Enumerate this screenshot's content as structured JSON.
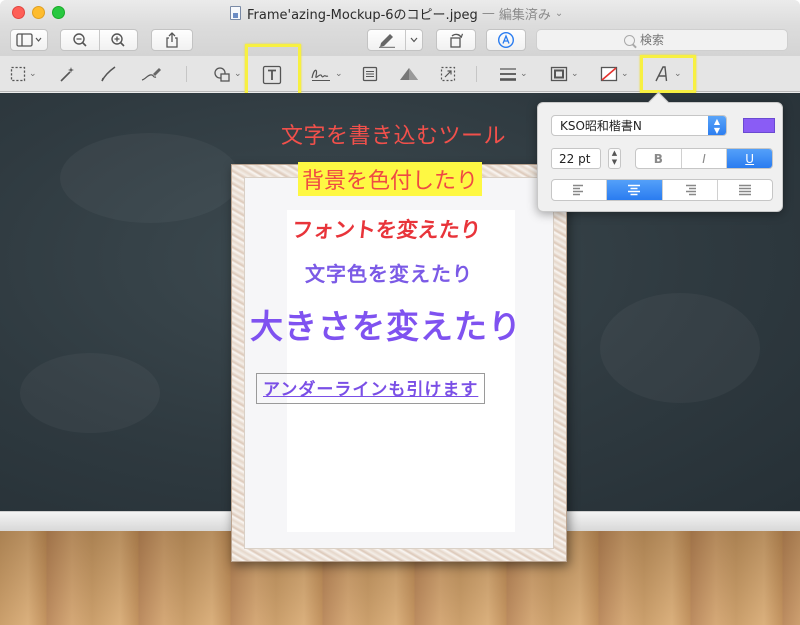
{
  "window": {
    "title": "Frame'azing-Mockup-6のコピー.jpeg",
    "title_separator": "—",
    "status": "編集済み"
  },
  "toolbar": {
    "search_placeholder": "検索"
  },
  "image_text": {
    "line1": "文字を書き込むツール",
    "line2": "背景を色付したり",
    "line3": "フォントを変えたり",
    "line4": "文字色を変えたり",
    "line5": "大きさを変えたり",
    "line6": "アンダーラインも引けます"
  },
  "font_popover": {
    "font_name": "KSO昭和楷書N",
    "font_size": "22 pt",
    "bold_label": "B",
    "italic_label": "I",
    "underline_label": "U",
    "active_style": "underline",
    "active_alignment": "center",
    "text_color": "#8a5cf5"
  },
  "colors": {
    "highlight": "#f7f041",
    "accent_blue": "#2a7cf0"
  },
  "icons": {
    "sidebar": "sidebar-icon",
    "zoom_out": "zoom-out-icon",
    "zoom_in": "zoom-in-icon",
    "share": "share-icon",
    "pen": "pen-icon",
    "rotate": "rotate-icon",
    "markup": "markup-icon",
    "search": "search-icon"
  }
}
